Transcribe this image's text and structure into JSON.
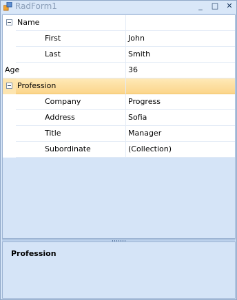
{
  "window": {
    "title": "RadForm1",
    "minimize_glyph": "_",
    "maximize_glyph": "□",
    "close_glyph": "✕"
  },
  "property_grid": {
    "rows": [
      {
        "name": "Name",
        "value": "",
        "level": 0,
        "expandable": true
      },
      {
        "name": "First",
        "value": "John",
        "level": 1,
        "expandable": false
      },
      {
        "name": "Last",
        "value": "Smith",
        "level": 1,
        "expandable": false
      },
      {
        "name": "Age",
        "value": "36",
        "level": 0,
        "expandable": false
      },
      {
        "name": "Profession",
        "value": "",
        "level": 0,
        "expandable": true,
        "selected": true
      },
      {
        "name": "Company",
        "value": "Progress",
        "level": 1,
        "expandable": false
      },
      {
        "name": "Address",
        "value": "Sofia",
        "level": 1,
        "expandable": false
      },
      {
        "name": "Title",
        "value": "Manager",
        "level": 1,
        "expandable": false
      },
      {
        "name": "Subordinate",
        "value": "(Collection)",
        "level": 1,
        "expandable": false
      }
    ],
    "selected_color": "#fbd58a"
  },
  "help_panel": {
    "title": "Profession"
  }
}
